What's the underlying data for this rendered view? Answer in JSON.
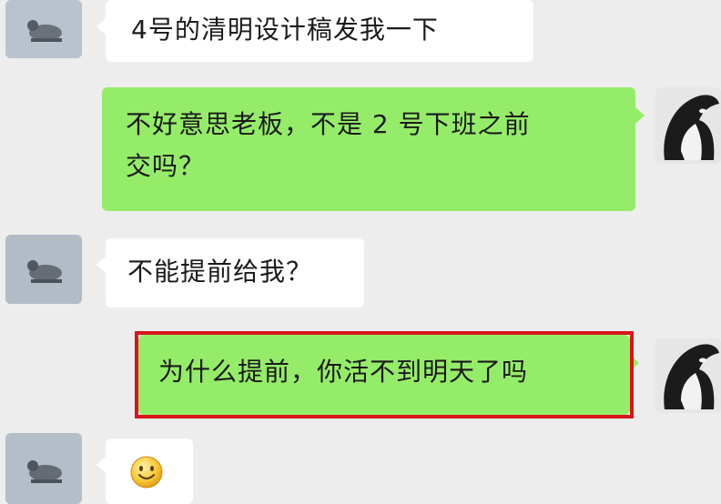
{
  "messages": [
    {
      "side": "left",
      "text": "4号的清明设计稿发我一下",
      "avatar": "avatar-dog-icon"
    },
    {
      "side": "right",
      "lines": [
        "不好意思老板，不是 2 号下班之前",
        "交吗？"
      ],
      "avatar": "avatar-orca-icon"
    },
    {
      "side": "left",
      "text": "不能提前给我？",
      "avatar": "avatar-dog-icon"
    },
    {
      "side": "right",
      "text": "为什么提前，你活不到明天了吗",
      "avatar": "avatar-orca-icon",
      "highlighted": true
    },
    {
      "side": "left",
      "emoji": "smile-emoji-icon",
      "avatar": "avatar-dog-icon"
    }
  ],
  "colors": {
    "background": "#ededed",
    "incoming_bubble": "#ffffff",
    "outgoing_bubble": "#95ec69",
    "highlight_border": "#d9141b"
  }
}
